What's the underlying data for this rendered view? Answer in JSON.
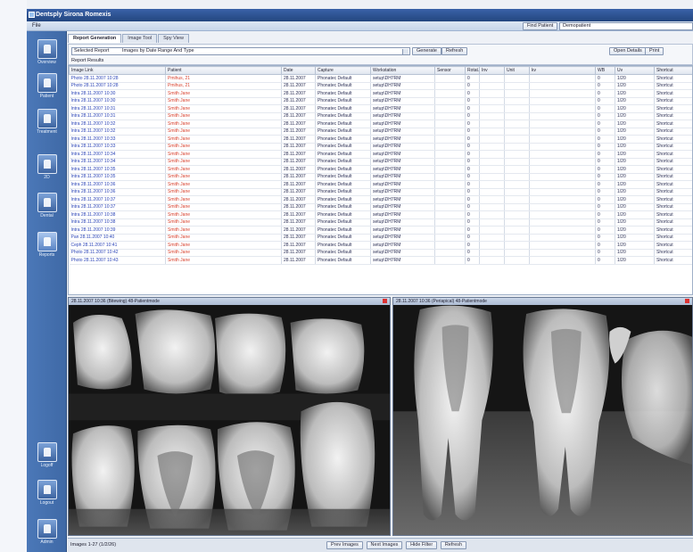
{
  "window": {
    "title": "Dentsply Sirona Romexis"
  },
  "menu": {
    "label": "File"
  },
  "toolbar": {
    "find_patient": "Find Patient",
    "search_value": "Demopatient"
  },
  "sidebar": {
    "items": [
      {
        "label": "Overview",
        "icon": "grid-icon"
      },
      {
        "label": "Patient",
        "icon": "patient-icon"
      },
      {
        "label": "Treatment",
        "icon": "treatment-icon"
      },
      {
        "label": "2D",
        "icon": "xray-2d-icon"
      },
      {
        "label": "Dental",
        "icon": "dental-unit-icon"
      },
      {
        "label": "Reports",
        "icon": "reports-icon"
      }
    ],
    "bottom": [
      {
        "label": "Logoff",
        "icon": "logoff-icon"
      },
      {
        "label": "Logout",
        "icon": "logout-icon"
      },
      {
        "label": "Admin",
        "icon": "admin-icon"
      }
    ]
  },
  "tabs": [
    "Report Generation",
    "Image Tool",
    "Spy View"
  ],
  "filter": {
    "label": "Selected Report",
    "value": "Images by Date Range And Type",
    "generate": "Generate",
    "refresh": "Refresh",
    "open_details": "Open Details",
    "print": "Print"
  },
  "results_title": "Report Results",
  "table": {
    "columns": [
      "Image Link",
      "Patient",
      "Date",
      "Capture",
      "Workstation",
      "Sensor",
      "Rotat.",
      "Inv",
      "Unit",
      "kv",
      "WB",
      "Uv",
      "Shortcut"
    ],
    "rows": [
      [
        "Photo 28.11.2007 10:28",
        "Pmihus, 21",
        "28.11.2007",
        "Phonatec Default",
        "setup\\DH7RM",
        "",
        "0",
        "",
        "",
        "",
        "0",
        "1/20",
        "Shortcut"
      ],
      [
        "Photo 28.11.2007 10:28",
        "Pmihus, 21",
        "28.11.2007",
        "Phonatec Default",
        "setup\\DH7RM",
        "",
        "0",
        "",
        "",
        "",
        "0",
        "1/20",
        "Shortcut"
      ],
      [
        "Intra 28.11.2007 10:30",
        "Smith Jane",
        "28.11.2007",
        "Phonatec Default",
        "setup\\DH7RM",
        "",
        "0",
        "",
        "",
        "",
        "0",
        "1/20",
        "Shortcut"
      ],
      [
        "Intra 28.11.2007 10:30",
        "Smith Jane",
        "28.11.2007",
        "Phonatec Default",
        "setup\\DH7RM",
        "",
        "0",
        "",
        "",
        "",
        "0",
        "1/20",
        "Shortcut"
      ],
      [
        "Intra 28.11.2007 10:31",
        "Smith Jane",
        "28.11.2007",
        "Phonatec Default",
        "setup\\DH7RM",
        "",
        "0",
        "",
        "",
        "",
        "0",
        "1/20",
        "Shortcut"
      ],
      [
        "Intra 28.11.2007 10:31",
        "Smith Jane",
        "28.11.2007",
        "Phonatec Default",
        "setup\\DH7RM",
        "",
        "0",
        "",
        "",
        "",
        "0",
        "1/20",
        "Shortcut"
      ],
      [
        "Intra 28.11.2007 10:32",
        "Smith Jane",
        "28.11.2007",
        "Phonatec Default",
        "setup\\DH7RM",
        "",
        "0",
        "",
        "",
        "",
        "0",
        "1/20",
        "Shortcut"
      ],
      [
        "Intra 28.11.2007 10:32",
        "Smith Jane",
        "28.11.2007",
        "Phonatec Default",
        "setup\\DH7RM",
        "",
        "0",
        "",
        "",
        "",
        "0",
        "1/20",
        "Shortcut"
      ],
      [
        "Intra 28.11.2007 10:33",
        "Smith Jane",
        "28.11.2007",
        "Phonatec Default",
        "setup\\DH7RM",
        "",
        "0",
        "",
        "",
        "",
        "0",
        "1/20",
        "Shortcut"
      ],
      [
        "Intra 28.11.2007 10:33",
        "Smith Jane",
        "28.11.2007",
        "Phonatec Default",
        "setup\\DH7RM",
        "",
        "0",
        "",
        "",
        "",
        "0",
        "1/20",
        "Shortcut"
      ],
      [
        "Intra 28.11.2007 10:34",
        "Smith Jane",
        "28.11.2007",
        "Phonatec Default",
        "setup\\DH7RM",
        "",
        "0",
        "",
        "",
        "",
        "0",
        "1/20",
        "Shortcut"
      ],
      [
        "Intra 28.11.2007 10:34",
        "Smith Jane",
        "28.11.2007",
        "Phonatec Default",
        "setup\\DH7RM",
        "",
        "0",
        "",
        "",
        "",
        "0",
        "1/20",
        "Shortcut"
      ],
      [
        "Intra 28.11.2007 10:35",
        "Smith Jane",
        "28.11.2007",
        "Phonatec Default",
        "setup\\DH7RM",
        "",
        "0",
        "",
        "",
        "",
        "0",
        "1/20",
        "Shortcut"
      ],
      [
        "Intra 28.11.2007 10:35",
        "Smith Jane",
        "28.11.2007",
        "Phonatec Default",
        "setup\\DH7RM",
        "",
        "0",
        "",
        "",
        "",
        "0",
        "1/20",
        "Shortcut"
      ],
      [
        "Intra 28.11.2007 10:36",
        "Smith Jane",
        "28.11.2007",
        "Phonatec Default",
        "setup\\DH7RM",
        "",
        "0",
        "",
        "",
        "",
        "0",
        "1/20",
        "Shortcut"
      ],
      [
        "Intra 28.11.2007 10:36",
        "Smith Jane",
        "28.11.2007",
        "Phonatec Default",
        "setup\\DH7RM",
        "",
        "0",
        "",
        "",
        "",
        "0",
        "1/20",
        "Shortcut"
      ],
      [
        "Intra 28.11.2007 10:37",
        "Smith Jane",
        "28.11.2007",
        "Phonatec Default",
        "setup\\DH7RM",
        "",
        "0",
        "",
        "",
        "",
        "0",
        "1/20",
        "Shortcut"
      ],
      [
        "Intra 28.11.2007 10:37",
        "Smith Jane",
        "28.11.2007",
        "Phonatec Default",
        "setup\\DH7RM",
        "",
        "0",
        "",
        "",
        "",
        "0",
        "1/20",
        "Shortcut"
      ],
      [
        "Intra 28.11.2007 10:38",
        "Smith Jane",
        "28.11.2007",
        "Phonatec Default",
        "setup\\DH7RM",
        "",
        "0",
        "",
        "",
        "",
        "0",
        "1/20",
        "Shortcut"
      ],
      [
        "Intra 28.11.2007 10:38",
        "Smith Jane",
        "28.11.2007",
        "Phonatec Default",
        "setup\\DH7RM",
        "",
        "0",
        "",
        "",
        "",
        "0",
        "1/20",
        "Shortcut"
      ],
      [
        "Intra 28.11.2007 10:39",
        "Smith Jane",
        "28.11.2007",
        "Phonatec Default",
        "setup\\DH7RM",
        "",
        "0",
        "",
        "",
        "",
        "0",
        "1/20",
        "Shortcut"
      ],
      [
        "Pan 28.11.2007 10:40",
        "Smith Jane",
        "28.11.2007",
        "Phonatec Default",
        "setup\\DH7RM",
        "",
        "0",
        "",
        "",
        "",
        "0",
        "1/20",
        "Shortcut"
      ],
      [
        "Ceph 28.11.2007 10:41",
        "Smith Jane",
        "28.11.2007",
        "Phonatec Default",
        "setup\\DH7RM",
        "",
        "0",
        "",
        "",
        "",
        "0",
        "1/20",
        "Shortcut"
      ],
      [
        "Photo 28.11.2007 10:42",
        "Smith Jane",
        "28.11.2007",
        "Phonatec Default",
        "setup\\DH7RM",
        "",
        "0",
        "",
        "",
        "",
        "0",
        "1/20",
        "Shortcut"
      ],
      [
        "Photo 28.11.2007 10:43",
        "Smith Jane",
        "28.11.2007",
        "Phonatec Default",
        "setup\\DH7RM",
        "",
        "0",
        "",
        "",
        "",
        "0",
        "1/20",
        "Shortcut"
      ]
    ]
  },
  "viewers": {
    "left_caption": "28.11.2007 10:36 (Bitewing) 48-Patientmode",
    "right_caption": "28.11.2007 10:36 (Periapical) 48-Patientmode"
  },
  "status": {
    "text": "Images 1-27 (1/2/26)",
    "buttons": [
      "Prev Images",
      "Next Images",
      "Hide Filter",
      "Refresh"
    ]
  }
}
